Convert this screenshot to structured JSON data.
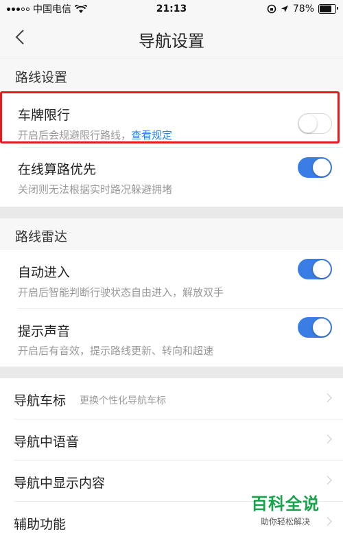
{
  "status": {
    "carrier": "中国电信",
    "time": "21:13",
    "battery": "78%",
    "battery_level": 0.78
  },
  "nav": {
    "title": "导航设置"
  },
  "route_section": {
    "header": "路线设置",
    "items": [
      {
        "title": "车牌限行",
        "subtitle": "开启后会规避限行路线，",
        "link": "查看规定",
        "on": false
      },
      {
        "title": "在线算路优先",
        "subtitle": "关闭则无法根据实时路况躲避拥堵",
        "on": true
      }
    ]
  },
  "radar_section": {
    "header": "路线雷达",
    "items": [
      {
        "title": "自动进入",
        "subtitle": "开启后智能判断行驶状态自由进入，解放双手",
        "on": true
      },
      {
        "title": "提示声音",
        "subtitle": "开启后有音效，提示路线更新、转向和超速",
        "on": true
      }
    ]
  },
  "nav_items": [
    {
      "title": "导航车标",
      "desc": "更换个性化导航车标"
    },
    {
      "title": "导航中语音"
    },
    {
      "title": "导航中显示内容"
    },
    {
      "title": "辅助功能"
    }
  ],
  "watermark": {
    "main": "百科全说",
    "sub": "助你轻松解决"
  },
  "colors": {
    "accent": "#3a7de4",
    "highlight": "#e21b1b",
    "watermark": "#16a34a"
  }
}
